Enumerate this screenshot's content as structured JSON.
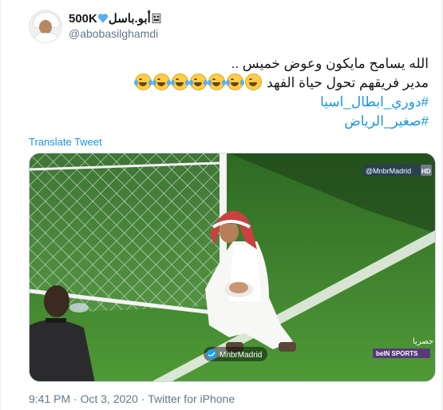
{
  "user": {
    "display_name": "أبو.باسل",
    "follower_tag": "500K",
    "handle": "@abobasilghamdi"
  },
  "tweet": {
    "line1": "الله يسامح مايكون وعوض خميس ..",
    "line2": "مدير فريقهم تحول حياة الفهد",
    "emoji_count": 7,
    "hashtag1": "#دوري_ابطال_اسيا",
    "hashtag2": "#صغير_الرياض",
    "translate_label": "Translate Tweet"
  },
  "media": {
    "watermark_top": "@MnbrMadrid",
    "watermark_hd": "HD",
    "watermark_center": "MnbrMadrid",
    "channel_label": "حصريا",
    "channel_brand": "beIN SPORTS"
  },
  "meta": {
    "time": "9:41 PM",
    "date": "Oct 3, 2020",
    "source": "Twitter for iPhone",
    "separator": "·"
  },
  "colors": {
    "link": "#1b95e0",
    "secondary_text": "#657786",
    "pitch_green": "#4b8f34"
  }
}
